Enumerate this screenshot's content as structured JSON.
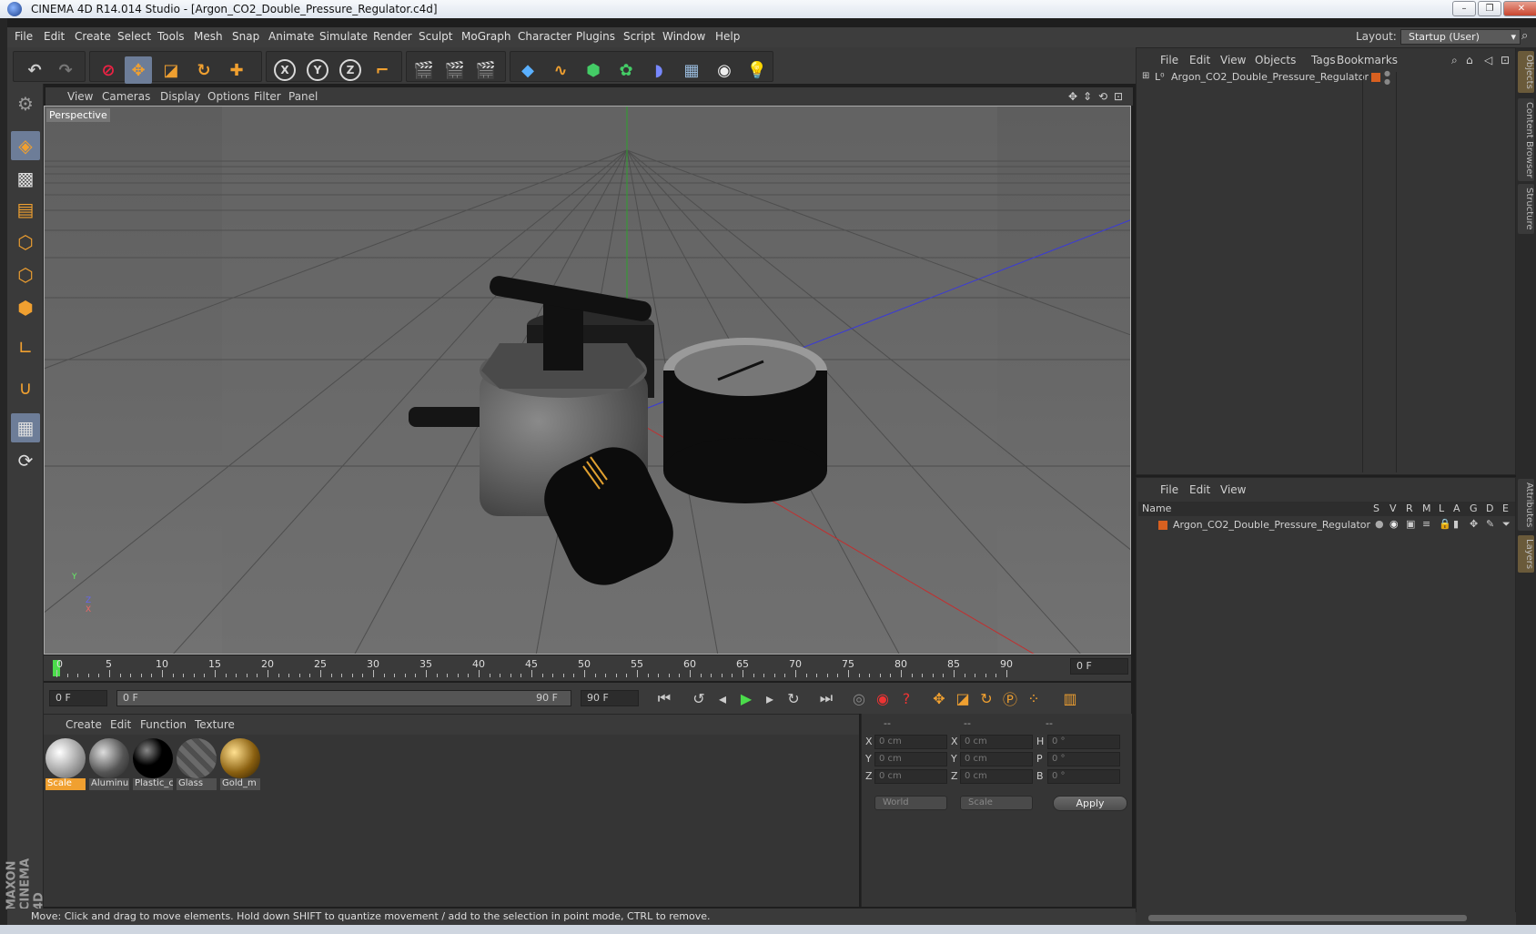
{
  "window": {
    "title": "CINEMA 4D R14.014 Studio - [Argon_CO2_Double_Pressure_Regulator.c4d]",
    "min": "–",
    "max": "❐",
    "close": "✕"
  },
  "menubar": {
    "items": [
      "File",
      "Edit",
      "Create",
      "Select",
      "Tools",
      "Mesh",
      "Snap",
      "Animate",
      "Simulate",
      "Render",
      "Sculpt",
      "MoGraph",
      "Character",
      "Plugins",
      "Script",
      "Window",
      "Help"
    ],
    "layout_label": "Layout:",
    "layout_value": "Startup (User)"
  },
  "toolbar": {
    "undo_icon": "undo-icon",
    "redo_icon": "redo-icon",
    "axis_x": "X",
    "axis_y": "Y",
    "axis_z": "Z"
  },
  "viewport": {
    "menu": [
      "View",
      "Cameras",
      "Display",
      "Options",
      "Filter",
      "Panel"
    ],
    "camera_label": "Perspective",
    "axis_y": "Y",
    "axis_z": "Z",
    "axis_x": "X"
  },
  "timeline": {
    "labels": [
      "0",
      "5",
      "10",
      "15",
      "20",
      "25",
      "30",
      "35",
      "40",
      "45",
      "50",
      "55",
      "60",
      "65",
      "70",
      "75",
      "80",
      "85",
      "90"
    ],
    "current_frame_field": "0 F",
    "current_frame": 0
  },
  "transport": {
    "start_field": "0 F",
    "range_start": "0 F",
    "range_end": "90 F",
    "end_field": "90 F"
  },
  "materials": {
    "menu": [
      "Create",
      "Edit",
      "Function",
      "Texture"
    ],
    "items": [
      {
        "name": "Scale"
      },
      {
        "name": "Aluminu"
      },
      {
        "name": "Plastic_c"
      },
      {
        "name": "Glass"
      },
      {
        "name": "Gold_m"
      }
    ]
  },
  "coords": {
    "headers": [
      "--",
      "--",
      "--"
    ],
    "rows": [
      {
        "a1": "X",
        "v1": "0 cm",
        "a2": "X",
        "v2": "0 cm",
        "a3": "H",
        "v3": "0 °"
      },
      {
        "a1": "Y",
        "v1": "0 cm",
        "a2": "Y",
        "v2": "0 cm",
        "a3": "P",
        "v3": "0 °"
      },
      {
        "a1": "Z",
        "v1": "0 cm",
        "a2": "Z",
        "v2": "0 cm",
        "a3": "B",
        "v3": "0 °"
      }
    ],
    "space": "World",
    "mode": "Scale",
    "apply": "Apply"
  },
  "objects_panel": {
    "menu": [
      "File",
      "Edit",
      "View",
      "Objects",
      "Tags",
      "Bookmarks"
    ],
    "object_name": "Argon_CO2_Double_Pressure_Regulator"
  },
  "layers_panel": {
    "menu": [
      "File",
      "Edit",
      "View"
    ],
    "columns": [
      "Name",
      "S",
      "V",
      "R",
      "M",
      "L",
      "A",
      "G",
      "D",
      "E"
    ],
    "layer_name": "Argon_CO2_Double_Pressure_Regulator"
  },
  "right_tabs": [
    "Objects",
    "Content Browser",
    "Structure",
    "Attributes",
    "Layers"
  ],
  "brand": "MAXON CINEMA 4D",
  "status": "Move: Click and drag to move elements. Hold down SHIFT to quantize movement / add to the selection in point mode, CTRL to remove.",
  "colors": {
    "accent_orange": "#f0a030",
    "selection_blue": "#6d7d98",
    "playhead_green": "#4bdc4b",
    "layer_color": "#d86020"
  }
}
